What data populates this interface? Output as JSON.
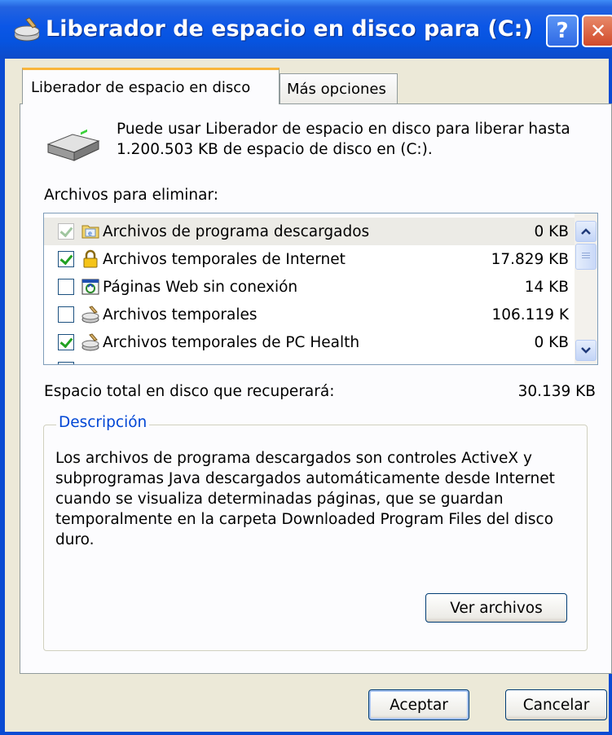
{
  "window": {
    "title": "Liberador de espacio en disco para  (C:)",
    "help_label": "?",
    "close_label": "✕"
  },
  "tabs": [
    {
      "label": "Liberador de espacio en disco",
      "active": true
    },
    {
      "label": "Más opciones",
      "active": false
    }
  ],
  "intro": "Puede usar Liberador de espacio en disco para liberar hasta 1.200.503 KB de espacio de disco en  (C:).",
  "files_label": "Archivos para eliminar:",
  "files": [
    {
      "name": "Archivos de programa descargados",
      "size": "0 KB",
      "checked": true,
      "disabled": true,
      "selected": true,
      "icon": "downloaded-program-icon"
    },
    {
      "name": "Archivos temporales de Internet",
      "size": "17.829 KB",
      "checked": true,
      "disabled": false,
      "selected": false,
      "icon": "lock-icon"
    },
    {
      "name": "Páginas Web sin conexión",
      "size": "14 KB",
      "checked": false,
      "disabled": false,
      "selected": false,
      "icon": "offline-pages-icon"
    },
    {
      "name": "Archivos temporales",
      "size": "106.119 K",
      "checked": false,
      "disabled": false,
      "selected": false,
      "icon": "cleanup-icon"
    },
    {
      "name": "Archivos temporales de PC Health",
      "size": "0 KB",
      "checked": true,
      "disabled": false,
      "selected": false,
      "icon": "cleanup-icon"
    }
  ],
  "total": {
    "label": "Espacio total en disco que recuperará:",
    "value": "30.139 KB"
  },
  "description": {
    "legend": "Descripción",
    "text": "Los archivos de programa descargados son controles ActiveX y subprogramas Java descargados automáticamente desde Internet cuando se visualiza determinadas páginas, que se guardan temporalmente en la carpeta Downloaded Program Files del disco duro.",
    "view_files_label": "Ver archivos"
  },
  "buttons": {
    "ok_label": "Aceptar",
    "cancel_label": "Cancelar"
  },
  "colors": {
    "titlebar": "#0654e0",
    "legend": "#0046d5",
    "check": "#21a121",
    "tab_accent": "#f9b53a"
  }
}
